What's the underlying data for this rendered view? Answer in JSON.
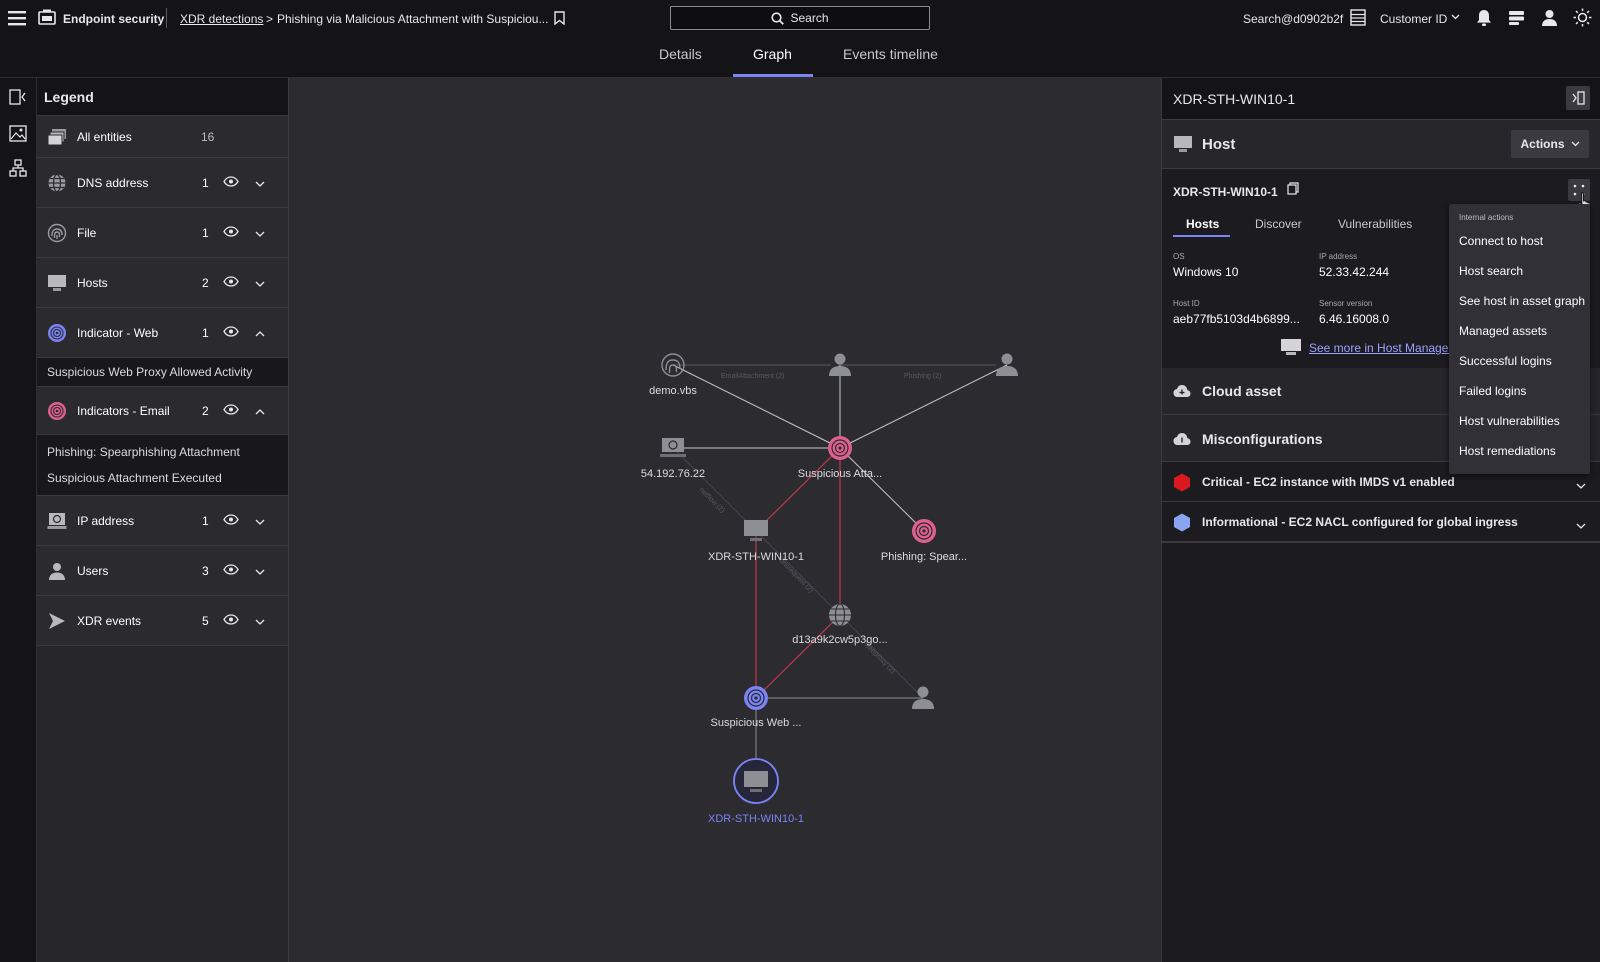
{
  "topbar": {
    "app_name": "Endpoint security",
    "breadcrumb_link": "XDR detections",
    "breadcrumb_sep": ">",
    "breadcrumb_current": "Phishing via Malicious Attachment with Suspiciou...",
    "search_label": "Search",
    "user": "Search@d0902b2f",
    "customer_id": "Customer ID"
  },
  "tabs": [
    {
      "label": "Details"
    },
    {
      "label": "Graph"
    },
    {
      "label": "Events timeline"
    }
  ],
  "active_tab": "Graph",
  "legend": {
    "title": "Legend",
    "all_entities": {
      "label": "All entities",
      "count": "16"
    },
    "items": [
      {
        "label": "DNS address",
        "count": "1",
        "icon": "globe-icon"
      },
      {
        "label": "File",
        "count": "1",
        "icon": "fingerprint-icon"
      },
      {
        "label": "Hosts",
        "count": "2",
        "icon": "monitor-icon"
      },
      {
        "label": "Indicator - Web",
        "count": "1",
        "icon": "indicator-web-icon",
        "color": "#7b84f5",
        "expanded": true,
        "children": [
          "Suspicious Web Proxy Allowed Activity"
        ]
      },
      {
        "label": "Indicators - Email",
        "count": "2",
        "icon": "indicator-email-icon",
        "color": "#f17a9c",
        "expanded": true,
        "children": [
          "Phishing: Spearphishing Attachment",
          "Suspicious Attachment Executed"
        ]
      },
      {
        "label": "IP address",
        "count": "1",
        "icon": "ip-address-icon"
      },
      {
        "label": "Users",
        "count": "3",
        "icon": "user-icon"
      },
      {
        "label": "XDR events",
        "count": "5",
        "icon": "xdr-arrow-icon"
      }
    ]
  },
  "graph": {
    "edge_labels": {
      "email_attachment": "EmailAttachment (2)",
      "phishing": "Phishing (2)",
      "netflow": "netflow (2)",
      "dnsrequest": "dnsrequest (2)",
      "webproxy": "webproxy (2)"
    },
    "nodes": {
      "demo_vbs": "demo.vbs",
      "ip": "54.192.76.22",
      "suspicious_att": "Suspicious Atta...",
      "host_mid": "XDR-STH-WIN10-1",
      "phishing_spear": "Phishing: Spear...",
      "dns": "d13a9k2cw5p3go...",
      "suspicious_web": "Suspicious Web ...",
      "host_selected": "XDR-STH-WIN10-1"
    },
    "colors": {
      "email_indicator": "#e0608c",
      "web_indicator": "#7b84f5",
      "red_edge": "#c0394b",
      "gray_edge": "#8d8d93",
      "entity": "#8e8e95"
    }
  },
  "panel": {
    "title": "XDR-STH-WIN10-1",
    "host_section": {
      "title": "Host",
      "actions_label": "Actions",
      "hostname": "XDR-STH-WIN10-1",
      "subtabs": [
        "Hosts",
        "Discover",
        "Vulnerabilities",
        "I"
      ],
      "active_subtab": "Hosts",
      "fields": [
        {
          "label": "OS",
          "value": "Windows 10"
        },
        {
          "label": "IP address",
          "value": "52.33.42.244"
        },
        {
          "label": "Host ID",
          "value": "aeb77fb5103d4b6899..."
        },
        {
          "label": "Sensor version",
          "value": "6.46.16008.0"
        }
      ],
      "see_more": "See more in Host Managem"
    },
    "cloud_asset": {
      "title": "Cloud asset"
    },
    "misconfigurations": {
      "title": "Misconfigurations",
      "items": [
        {
          "label": "Critical - EC2 instance with IMDS v1 enabled",
          "color": "#d9191f"
        },
        {
          "label": "Informational - EC2 NACL configured for global ingress",
          "color": "#8aa4f0"
        }
      ]
    }
  },
  "menu": {
    "header": "Internal actions",
    "items": [
      "Connect to host",
      "Host search",
      "See host in asset graph",
      "Managed assets",
      "Successful logins",
      "Failed logins",
      "Host vulnerabilities",
      "Host remediations"
    ]
  }
}
